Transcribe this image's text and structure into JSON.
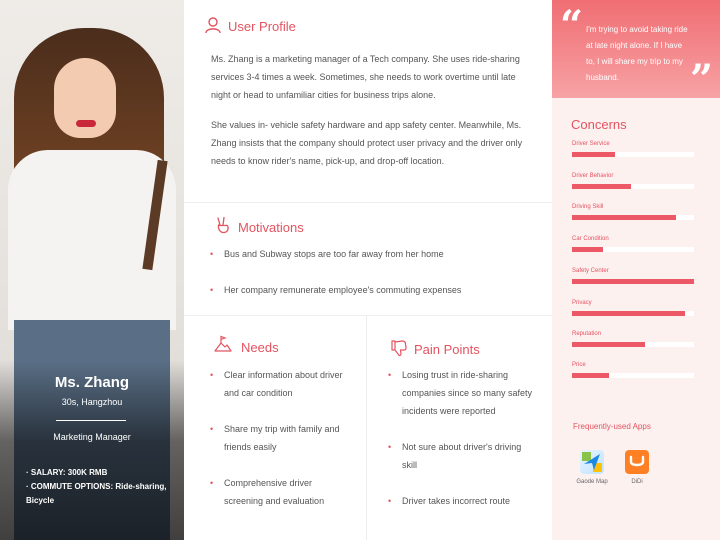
{
  "persona": {
    "name": "Ms. Zhang",
    "age_location": "30s, Hangzhou",
    "role": "Marketing Manager",
    "facts": [
      "· SALARY: 300K RMB",
      "· COMMUTE OPTIONS: Ride-sharing, Bicycle"
    ]
  },
  "profile": {
    "title": "User Profile",
    "paragraphs": [
      "Ms. Zhang is a marketing manager of a Tech company. She uses ride-sharing services 3-4 times a week. Sometimes, she needs to work overtime until late night or head to unfamiliar cities for business trips alone.",
      "She values in- vehicle safety hardware and app safety center. Meanwhile, Ms. Zhang insists that the company should protect user privacy and the driver only needs to know rider's name, pick-up, and drop-off location."
    ]
  },
  "motivations": {
    "title": "Motivations",
    "items": [
      "Bus and Subway stops are too far away from her home",
      "Her company remunerate employee's commuting expenses"
    ]
  },
  "needs": {
    "title": "Needs",
    "items": [
      "Clear information about driver and car condition",
      "Share my trip with family and friends easily",
      "Comprehensive driver screening and evaluation"
    ]
  },
  "pain_points": {
    "title": "Pain Points",
    "items": [
      "Losing trust in ride-sharing companies since so many safety incidents were reported",
      "Not sure about driver's driving skill",
      "Driver takes incorrect route"
    ]
  },
  "quote": {
    "open_mark": "“",
    "close_mark": "”",
    "text": "I'm trying to avoid taking ride at late night alone. If I have to, I will share my trip to my husband."
  },
  "concerns": {
    "title": "Concerns",
    "items": [
      {
        "label": "Driver Service",
        "level": 0.35
      },
      {
        "label": "Driver Behavior",
        "level": 0.48
      },
      {
        "label": "Driving Skill",
        "level": 0.85
      },
      {
        "label": "Car Condition",
        "level": 0.25
      },
      {
        "label": "Safety Center",
        "level": 1.0
      },
      {
        "label": "Privacy",
        "level": 0.93
      },
      {
        "label": "Reputation",
        "level": 0.6
      },
      {
        "label": "Price",
        "level": 0.3
      }
    ]
  },
  "apps": {
    "title": "Frequently-used Apps",
    "items": [
      {
        "label": "Gaode Map",
        "icon": "gaode-map-icon"
      },
      {
        "label": "DiDi",
        "icon": "didi-icon"
      }
    ]
  },
  "colors": {
    "accent": "#e45360",
    "bar": "#ec5865",
    "panel": "#fdf1f0"
  }
}
